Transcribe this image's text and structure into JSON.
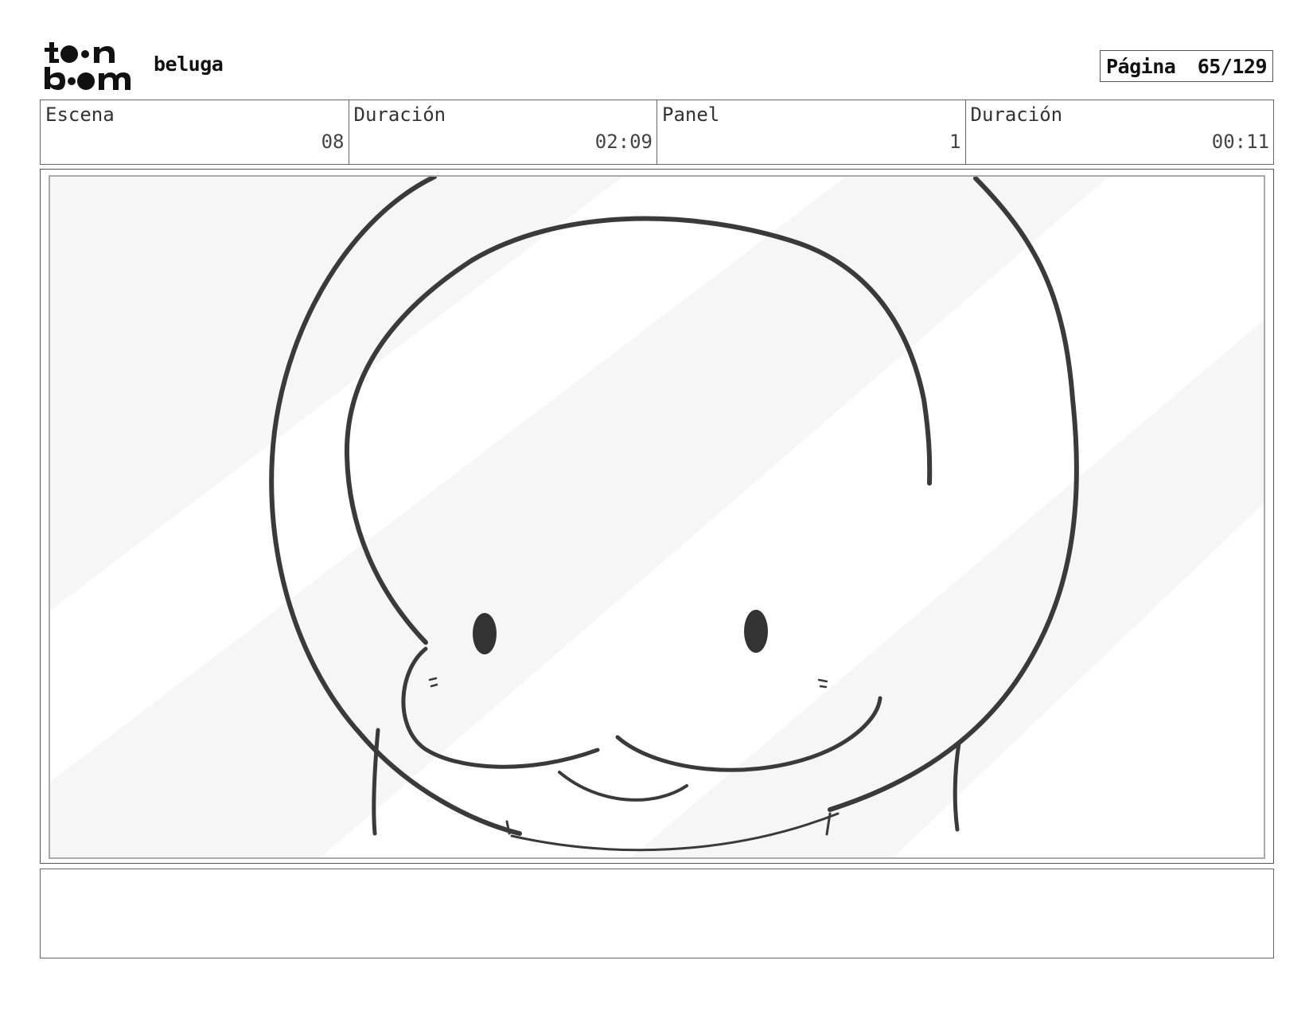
{
  "header": {
    "logo_text": "toon boom",
    "project": "beluga",
    "page_label": "Página",
    "page_number": "65/129"
  },
  "info": {
    "scene_label": "Escena",
    "scene_value": "08",
    "scene_duration_label": "Duración",
    "scene_duration_value": "02:09",
    "panel_label": "Panel",
    "panel_value": "1",
    "panel_duration_label": "Duración",
    "panel_duration_value": "00:11"
  },
  "notes": {
    "text": ""
  }
}
